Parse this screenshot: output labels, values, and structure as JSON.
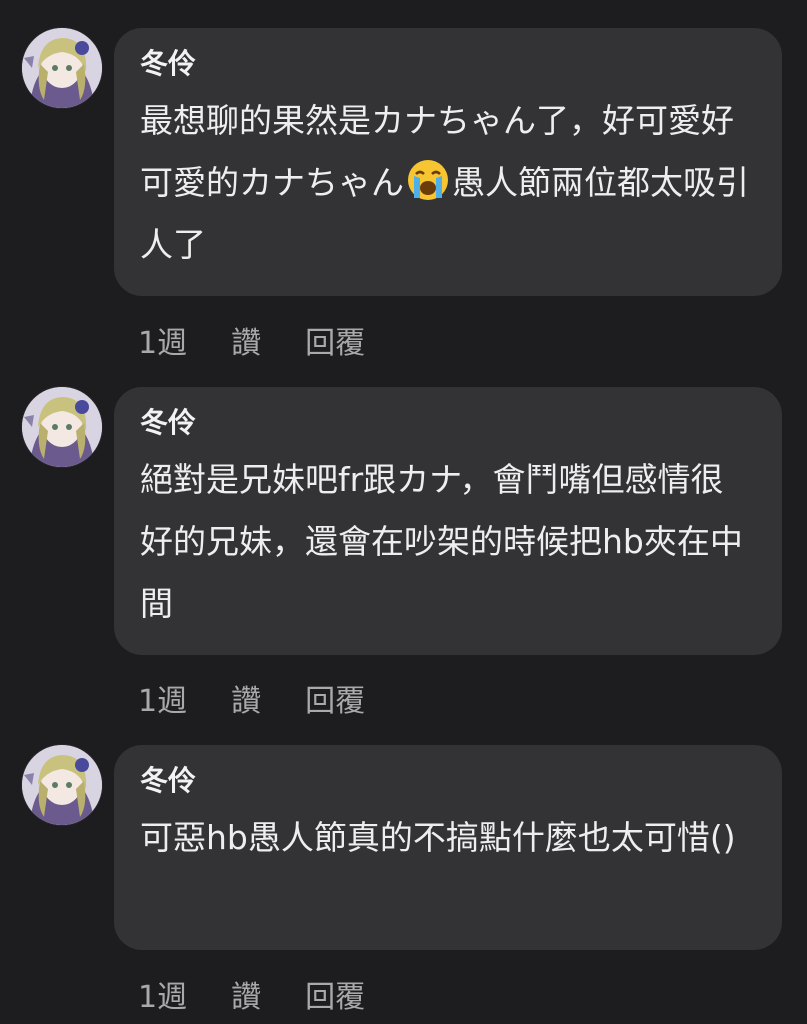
{
  "comments": [
    {
      "author": "冬伶",
      "text_before_emoji": "最想聊的果然是カナちゃん了，好可愛好可愛的カナちゃん",
      "emoji_icon": "crying-face-icon",
      "text_after_emoji": "愚人節兩位都太吸引人了",
      "time": "1週",
      "like_label": "讚",
      "reply_label": "回覆"
    },
    {
      "author": "冬伶",
      "text": "絕對是兄妹吧fr跟カナ，會鬥嘴但感情很好的兄妹，還會在吵架的時候把hb夾在中間",
      "time": "1週",
      "like_label": "讚",
      "reply_label": "回覆"
    },
    {
      "author": "冬伶",
      "text": "可惡hb愚人節真的不搞點什麼也太可惜()",
      "time": "1週",
      "like_label": "讚",
      "reply_label": "回覆"
    }
  ],
  "colors": {
    "background": "#1d1d1f",
    "bubble": "#333335",
    "text": "#eeeeee",
    "meta": "#a9a9ad"
  }
}
